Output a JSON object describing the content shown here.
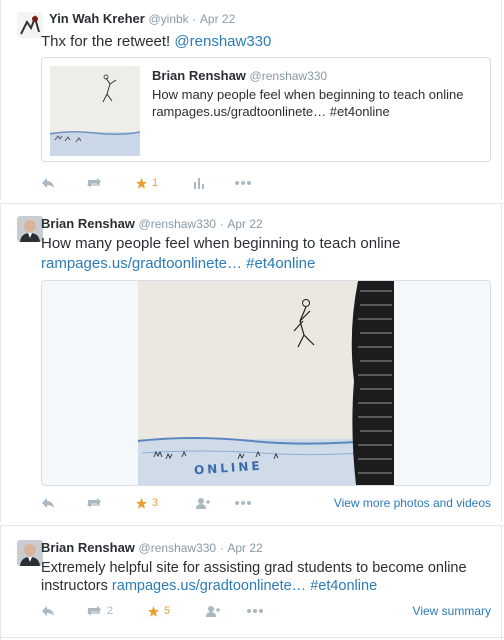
{
  "tweets": [
    {
      "name": "Yin Wah Kreher",
      "handle": "@yinbk",
      "dot": "·",
      "time": "Apr 22",
      "text": "Thx for the retweet!",
      "mention": "@renshaw330",
      "quote": {
        "name": "Brian Renshaw",
        "handle": "@renshaw330",
        "text": "How many people feel when beginning to teach online",
        "link": "rampages.us/gradtoonlinete… #et4online"
      },
      "favorite_count": "1"
    },
    {
      "name": "Brian Renshaw",
      "handle": "@renshaw330",
      "dot": "·",
      "time": "Apr 22",
      "text": "How many people feel when beginning to teach online",
      "link": "rampages.us/gradtoonlinete… #et4online",
      "favorite_count": "3",
      "more_link": "View more photos and videos",
      "drawing_text": "ONLINE"
    },
    {
      "name": "Brian Renshaw",
      "handle": "@renshaw330",
      "dot": "·",
      "time": "Apr 22",
      "text_line1": "Extremely helpful site for assisting grad students to become online",
      "text_line2_prefix": "instructors ",
      "text_line2_link": "rampages.us/gradtoonlinete… #et4online",
      "retweet_count": "2",
      "favorite_count": "5",
      "more_link": "View summary"
    }
  ],
  "icons": {
    "reply": "reply-icon",
    "retweet": "retweet-icon",
    "favorite": "star-icon",
    "stats": "bar-chart-icon",
    "more": "more-dots-icon",
    "follow": "add-user-icon"
  },
  "colors": {
    "link": "#2b7bb9",
    "favorite": "#e8a234",
    "muted": "#aab8c2",
    "border": "#e1e8ed"
  }
}
